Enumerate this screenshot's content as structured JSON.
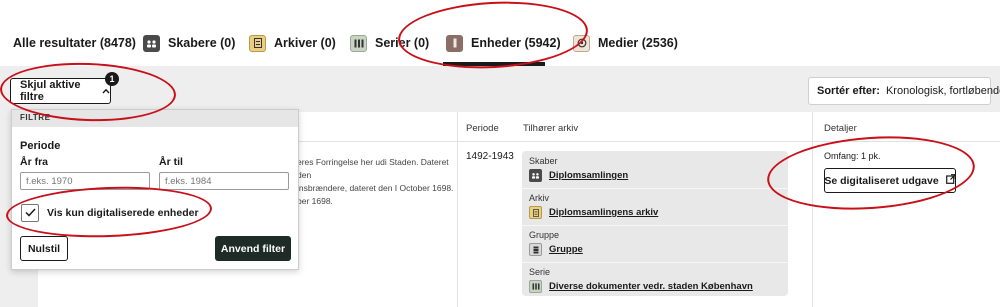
{
  "tabs": [
    {
      "label": "Alle resultater (8478)",
      "icon": "",
      "icon_color": ""
    },
    {
      "label": "Skabere (0)",
      "icon": "people-icon",
      "icon_color": "#4a4a4a"
    },
    {
      "label": "Arkiver (0)",
      "icon": "archive-icon",
      "icon_color": "#e8cf84"
    },
    {
      "label": "Serier (0)",
      "icon": "series-icon",
      "icon_color": "#c9d3c4"
    },
    {
      "label": "Enheder (5942)",
      "icon": "unit-icon",
      "icon_color": "#8b6e66"
    },
    {
      "label": "Medier (2536)",
      "icon": "media-icon",
      "icon_color": "#efe4d6"
    }
  ],
  "filters": {
    "toggle_label": "Skjul aktive filtre",
    "badge_count": "1",
    "panel": {
      "header": "FILTRE",
      "periode_title": "Periode",
      "from_label": "År fra",
      "from_placeholder": "f.eks. 1970",
      "to_label": "År til",
      "to_placeholder": "f.eks. 1984",
      "checkbox_label": "Vis kun digitaliserede enheder",
      "checkbox_checked": true,
      "reset_label": "Nulstil",
      "apply_label": "Anvend filter"
    }
  },
  "sort": {
    "label": "Sortér efter:",
    "value": "Kronologisk, fortløbende"
  },
  "table": {
    "headers": {
      "periode": "Periode",
      "arkiv": "Tilhører arkiv",
      "detaljer": "Detaljer"
    },
    "row": {
      "description_lines": [
        "eres Forringelse her udi Staden. Dateret den",
        "insbrændere, dateret den I October 1698.",
        "ber 1698."
      ],
      "periode": "1492-1943",
      "archive": [
        {
          "type": "Skaber",
          "name": "Diplomsamlingen",
          "icon": "people-icon",
          "color": "#4a4a4a"
        },
        {
          "type": "Arkiv",
          "name": "Diplomsamlingens arkiv",
          "icon": "archive-icon",
          "color": "#e8cf84"
        },
        {
          "type": "Gruppe",
          "name": "Gruppe",
          "icon": "group-icon",
          "color": "#d8d8d8"
        },
        {
          "type": "Serie",
          "name": "Diverse dokumenter vedr. staden København",
          "icon": "series-icon",
          "color": "#c9d3c4"
        }
      ],
      "omfang": "Omfang: 1 pk.",
      "digital_button": "Se digitaliseret udgave"
    }
  }
}
